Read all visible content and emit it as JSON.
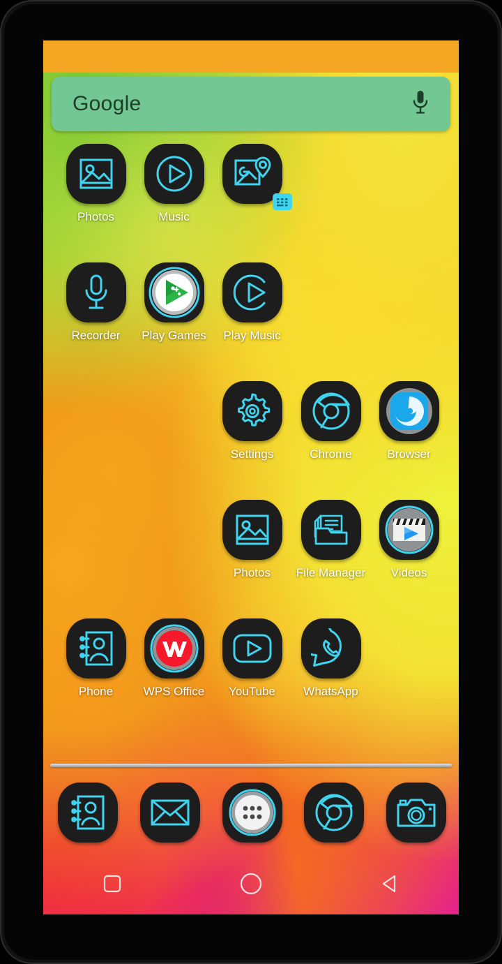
{
  "device": {
    "frame": "android-tablet-frame"
  },
  "statusbar": {
    "color": "#f5a623"
  },
  "search": {
    "hint": "Google",
    "mic_icon": "microphone-icon",
    "bg_color": "#72c792"
  },
  "home_screen": {
    "rows": [
      {
        "row_index": 1,
        "apps": [
          {
            "col": 1,
            "label": "Photos",
            "icon": "photos-icon",
            "style": "outline"
          },
          {
            "col": 2,
            "label": "Music",
            "icon": "music-icon",
            "style": "outline"
          },
          {
            "col": 3,
            "label": "",
            "icon": "maps-icon",
            "style": "outline",
            "badge": "grid-badge-icon"
          }
        ]
      },
      {
        "row_index": 2,
        "apps": [
          {
            "col": 1,
            "label": "Recorder",
            "icon": "microphone-icon",
            "style": "outline"
          },
          {
            "col": 2,
            "label": "Play Games",
            "icon": "play-games-icon",
            "style": "color"
          },
          {
            "col": 3,
            "label": "Play Music",
            "icon": "play-music-icon",
            "style": "outline"
          }
        ]
      },
      {
        "row_index": 3,
        "apps": [
          {
            "col": 3,
            "label": "Settings",
            "icon": "gear-icon",
            "style": "outline"
          },
          {
            "col": 4,
            "label": "Chrome",
            "icon": "chrome-icon",
            "style": "outline"
          },
          {
            "col": 5,
            "label": "Browser",
            "icon": "browser-icon",
            "style": "color"
          }
        ]
      },
      {
        "row_index": 4,
        "apps": [
          {
            "col": 3,
            "label": "Photos",
            "icon": "photos-icon",
            "style": "outline"
          },
          {
            "col": 4,
            "label": "File Manager",
            "icon": "file-manager-icon",
            "style": "outline"
          },
          {
            "col": 5,
            "label": "Videos",
            "icon": "videos-icon",
            "style": "color"
          }
        ]
      },
      {
        "row_index": 5,
        "apps": [
          {
            "col": 1,
            "label": "Phone",
            "icon": "contacts-book-icon",
            "style": "outline"
          },
          {
            "col": 2,
            "label": "WPS Office",
            "icon": "wps-office-icon",
            "style": "color"
          },
          {
            "col": 3,
            "label": "YouTube",
            "icon": "youtube-icon",
            "style": "outline"
          },
          {
            "col": 4,
            "label": "WhatsApp",
            "icon": "whatsapp-icon",
            "style": "outline"
          }
        ]
      }
    ]
  },
  "dock": {
    "items": [
      {
        "pos": 1,
        "icon": "contacts-book-icon",
        "name": "Contacts"
      },
      {
        "pos": 2,
        "icon": "email-icon",
        "name": "Email"
      },
      {
        "pos": 3,
        "icon": "app-drawer-icon",
        "name": "App Drawer"
      },
      {
        "pos": 4,
        "icon": "chrome-icon",
        "name": "Chrome"
      },
      {
        "pos": 5,
        "icon": "camera-icon",
        "name": "Camera"
      }
    ]
  },
  "navbar": {
    "buttons": [
      {
        "pos": 1,
        "icon": "recents-square-icon",
        "name": "Recents"
      },
      {
        "pos": 2,
        "icon": "home-circle-icon",
        "name": "Home"
      },
      {
        "pos": 3,
        "icon": "back-triangle-icon",
        "name": "Back"
      }
    ]
  },
  "theme": {
    "icon_tile_bg": "#1d1d1d",
    "icon_stroke": "#3fd4ef",
    "label_color": "#ffffff",
    "accent": "#3fd4ef"
  }
}
